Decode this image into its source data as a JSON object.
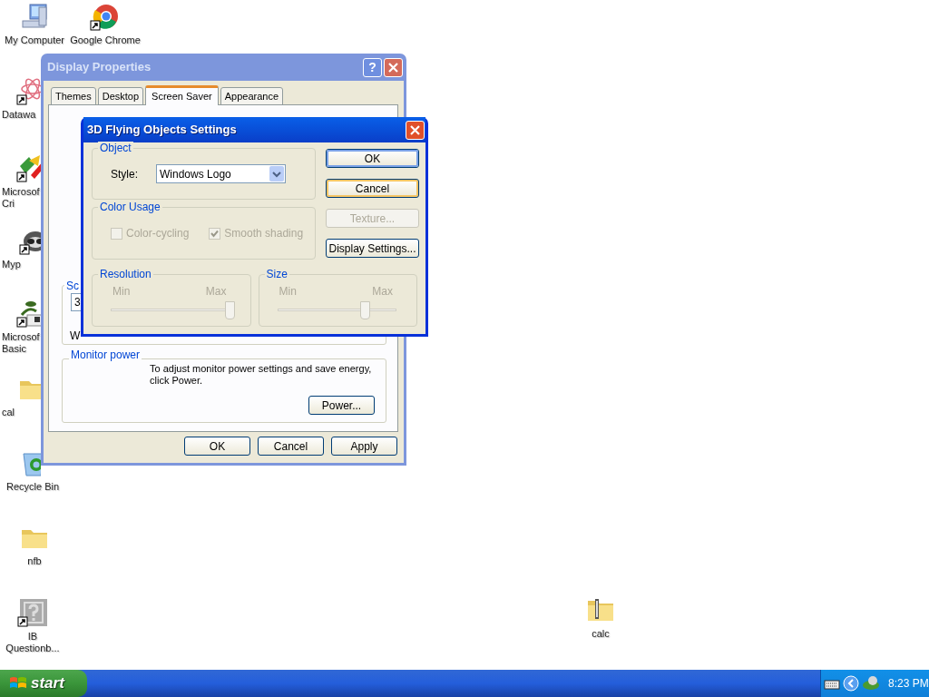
{
  "desktop_icons": [
    {
      "kind": "computer",
      "lines": [
        "My Computer"
      ]
    },
    {
      "kind": "browser",
      "lines": [
        "Google Chrome"
      ]
    },
    {
      "kind": "flower",
      "lines": [
        "Datawa"
      ]
    },
    {
      "kind": "shapes",
      "lines": [
        "Microsof",
        "Cri"
      ]
    },
    {
      "kind": "animal",
      "lines": [
        "Myp"
      ]
    },
    {
      "kind": "plant",
      "lines": [
        "Microsof",
        "Basic"
      ]
    },
    {
      "kind": "folder",
      "lines": [
        "cal"
      ]
    },
    {
      "kind": "recycle",
      "lines": [
        "Recycle Bin"
      ]
    },
    {
      "kind": "folder",
      "lines": [
        "nfb"
      ]
    },
    {
      "kind": "question",
      "lines": [
        "IB",
        "Questionb..."
      ]
    },
    {
      "kind": "zip",
      "lines": [
        "calc"
      ]
    }
  ],
  "display_properties": {
    "title": "Display Properties",
    "help_button": "?",
    "tabs": [
      {
        "label": "Themes",
        "selected": false
      },
      {
        "label": "Desktop",
        "selected": false
      },
      {
        "label": "Screen Saver",
        "selected": true
      },
      {
        "label": "Appearance",
        "selected": false
      }
    ],
    "screen_saver_group": {
      "title_fragment": "Sc",
      "field_fragment": "3",
      "text_fragment": "W"
    },
    "monitor_power": {
      "title": "Monitor power",
      "text": "To adjust monitor power settings and save energy, click Power.",
      "button": "Power..."
    },
    "buttons": [
      "OK",
      "Cancel",
      "Apply"
    ]
  },
  "settings_dialog": {
    "title": "3D Flying Objects Settings",
    "object_group": {
      "title": "Object",
      "style_label": "Style:",
      "style_value": "Windows Logo"
    },
    "color_usage": {
      "title": "Color Usage",
      "options": [
        {
          "label": "Color-cycling",
          "checked": false,
          "disabled": true
        },
        {
          "label": "Smooth shading",
          "checked": true,
          "disabled": true
        }
      ]
    },
    "sliders": [
      {
        "title": "Resolution",
        "min_label": "Min",
        "max_label": "Max",
        "level": 1.0,
        "disabled": true
      },
      {
        "title": "Size",
        "min_label": "Min",
        "max_label": "Max",
        "level": 0.74,
        "disabled": true
      }
    ],
    "buttons": [
      {
        "label": "OK",
        "focused": true,
        "hover": false,
        "disabled": false
      },
      {
        "label": "Cancel",
        "focused": false,
        "hover": true,
        "disabled": false
      },
      {
        "label": "Texture...",
        "focused": false,
        "hover": false,
        "disabled": true
      },
      {
        "label": "Display Settings...",
        "focused": false,
        "hover": false,
        "disabled": false
      }
    ]
  },
  "taskbar": {
    "start": "start",
    "clock": "8:23 PM"
  }
}
